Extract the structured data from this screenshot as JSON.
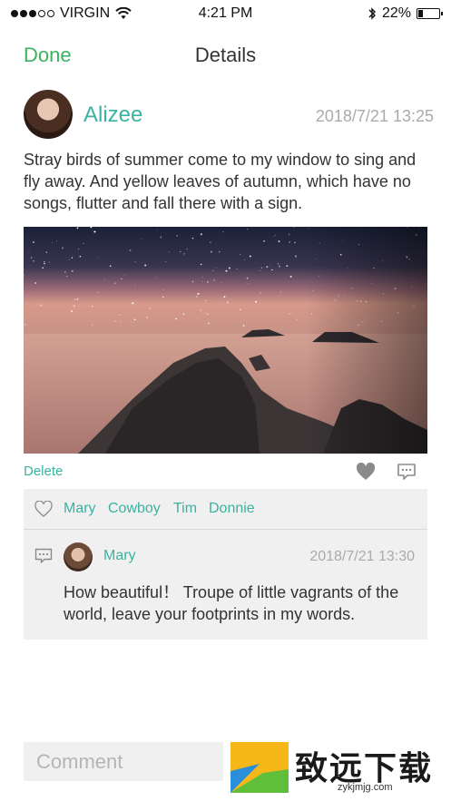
{
  "status_bar": {
    "carrier": "VIRGIN",
    "time": "4:21 PM",
    "battery": "22%",
    "battery_level": 0.22,
    "signal_bars": 3
  },
  "nav": {
    "done_label": "Done",
    "title": "Details"
  },
  "post": {
    "author": "Alizee",
    "time": "2018/7/21 13:25",
    "text": "Stray birds of summer come to my window to sing and fly away. And yellow leaves of autumn, which have no songs, flutter and fall there with a sign.",
    "delete_label": "Delete"
  },
  "likes": [
    "Mary",
    "Cowboy",
    "Tim",
    "Donnie"
  ],
  "comment": {
    "author": "Mary",
    "time": "2018/7/21 13:30",
    "text": "How beautiful！ Troupe of little vagrants of the world, leave your footprints in my words."
  },
  "comment_input": {
    "placeholder": "Comment"
  },
  "watermark": {
    "text": "致远下载",
    "url": "zykjmjg.com"
  },
  "colors": {
    "accent_green": "#3bb35e",
    "accent_teal": "#3bb3a0",
    "muted": "#aaaaaa",
    "panel": "#f0f0f0"
  }
}
